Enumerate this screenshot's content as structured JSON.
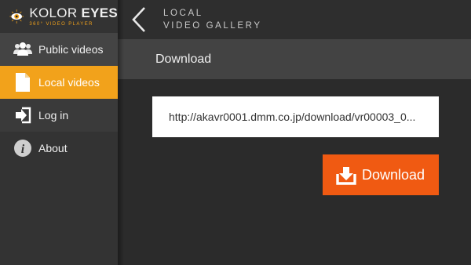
{
  "app": {
    "name_regular": "KOLOR ",
    "name_bold": "EYES",
    "subtitle": "360° VIDEO PLAYER"
  },
  "sidebar": {
    "items": [
      {
        "label": "Public videos",
        "icon": "users-icon"
      },
      {
        "label": "Local videos",
        "icon": "file-icon",
        "active": true
      },
      {
        "label": "Log in",
        "icon": "login-icon"
      },
      {
        "label": "About",
        "icon": "info-icon"
      }
    ]
  },
  "header": {
    "title_line1": "LOCAL",
    "title_line2": "VIDEO GALLERY"
  },
  "section": {
    "title": "Download"
  },
  "form": {
    "url_value": "http://akavr0001.dmm.co.jp/download/vr00003_0..."
  },
  "button": {
    "download_label": "Download"
  },
  "colors": {
    "accent": "#f2a21b",
    "download_button": "#f05a12",
    "sidebar_bg": "#333333",
    "section_bg": "#434343",
    "main_bg": "#2b2b2b"
  }
}
